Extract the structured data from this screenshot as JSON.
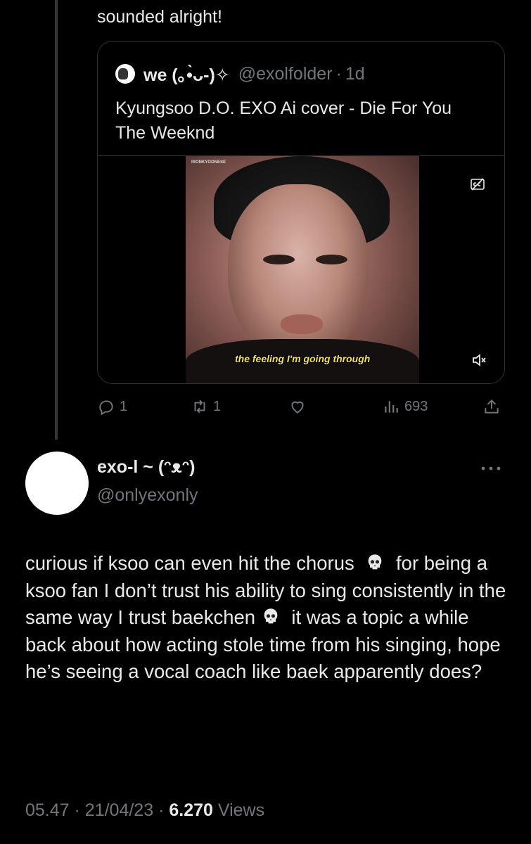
{
  "top_text": "sounded alright!",
  "quote": {
    "name": "we (｡•̀ᴗ-)✧",
    "handle": "@exolfolder",
    "separator": "·",
    "time": "1d",
    "text": "Kyungsoo D.O. EXO Ai cover - Die For You The Weeknd",
    "video": {
      "watermark": "IRONKYOONESE",
      "caption": "the feeling I'm going through"
    }
  },
  "actions": {
    "replies": "1",
    "retweets": "1",
    "views": "693"
  },
  "reply": {
    "name": "exo-l ~ (ᵔᴥᵔ)",
    "handle": "@onlyexonly",
    "text_parts": [
      "curious if ksoo can even hit the chorus",
      "for being a ksoo fan I don’t trust his ability to sing consistently in the same way I trust baekchen",
      "it was a topic a while back about how acting stole time from his singing, hope he’s seeing a vocal coach like baek apparently does?"
    ],
    "time": "05.47",
    "sep1": "·",
    "date": "21/04/23",
    "sep2": "·",
    "views_count": "6.270",
    "views_label": "Views"
  },
  "colors": {
    "background": "#000000",
    "text": "#e7e9ea",
    "muted": "#71767b",
    "border": "#2f3336"
  },
  "icons": [
    "reply-icon",
    "retweet-icon",
    "like-icon",
    "views-icon",
    "share-icon",
    "captions-icon",
    "mute-icon",
    "more-icon",
    "skull-icon"
  ]
}
